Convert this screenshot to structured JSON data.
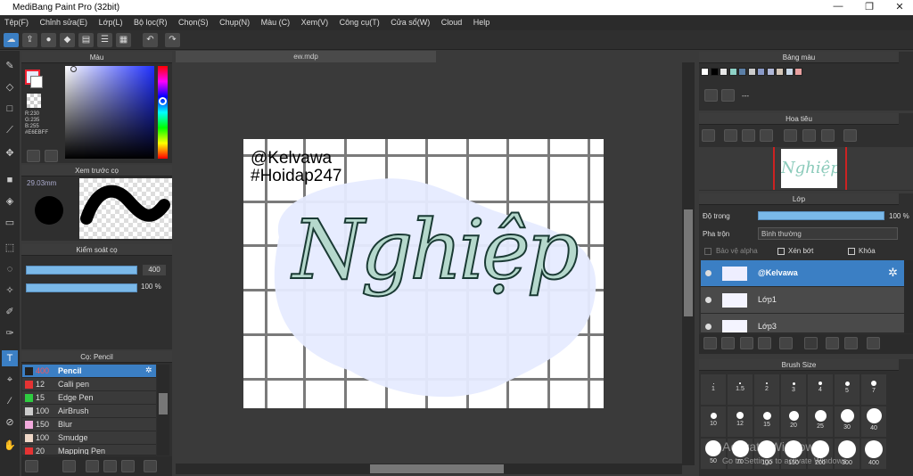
{
  "title": "MediBang Paint Pro (32bit)",
  "window_buttons": [
    "—",
    "❐",
    "✕"
  ],
  "menu": [
    "Tệp(F)",
    "Chỉnh sửa(E)",
    "Lớp(L)",
    "Bộ lọc(R)",
    "Chọn(S)",
    "Chụp(N)",
    "Màu (C)",
    "Xem(V)",
    "Công cụ(T)",
    "Cửa sổ(W)",
    "Cloud",
    "Help"
  ],
  "color_panel": {
    "title": "Màu",
    "r": "R:230",
    "g": "G:235",
    "b": "B:255",
    "hex": "#E6EBFF",
    "primary": "#e6ebff",
    "secondary": "#ffffff"
  },
  "preview_panel": {
    "title": "Xem trước cọ",
    "size": "29.03mm"
  },
  "control_panel": {
    "title": "Kiểm soát cọ",
    "size_value": "400",
    "opacity_value": "100 %"
  },
  "brush_panel": {
    "title": "Cọ: Pencil",
    "brushes": [
      {
        "size": "400",
        "name": "Pencil",
        "color": "#222222",
        "selected": true
      },
      {
        "size": "12",
        "name": "Calli pen",
        "color": "#e53333"
      },
      {
        "size": "15",
        "name": "Edge Pen",
        "color": "#2ecc40"
      },
      {
        "size": "100",
        "name": "AirBrush",
        "color": "#cccccc"
      },
      {
        "size": "150",
        "name": "Blur",
        "color": "#f2aadd"
      },
      {
        "size": "100",
        "name": "Smudge",
        "color": "#f0d8c8"
      },
      {
        "size": "20",
        "name": "Mapping Pen",
        "color": "#e53333"
      }
    ]
  },
  "document": {
    "tab": "ew.mdp",
    "watermark_line1": "@Kelvawa",
    "watermark_line2": "#Hoidap247",
    "lettering": "Nghiệp"
  },
  "palette_panel": {
    "title": "Bảng màu",
    "swatches": [
      "#ffffff",
      "#000000",
      "#e8e8e8",
      "#8ed1c6",
      "#5b7fa6",
      "#cccccc",
      "#8a9ac8",
      "#b0b8d8",
      "#d4c6b8",
      "#c8d8e8",
      "#e8a0a0"
    ],
    "ellipsis": "---"
  },
  "navigator_panel": {
    "title": "Hoa tiêu"
  },
  "layer_panel": {
    "title": "Lớp",
    "opacity_label": "Độ trong",
    "opacity_value": "100 %",
    "blend_label": "Pha trộn",
    "blend_value": "Bình thường",
    "protect_alpha": "Bảo vệ alpha",
    "clipping": "Xén bớt",
    "lock": "Khóa",
    "layers": [
      {
        "name": "@Kelvawa",
        "selected": true
      },
      {
        "name": "Lớp1"
      },
      {
        "name": "Lớp3"
      }
    ]
  },
  "brush_size_panel": {
    "title": "Brush Size",
    "rows": [
      [
        "1",
        "1.5",
        "2",
        "3",
        "4",
        "5",
        "7"
      ],
      [
        "10",
        "12",
        "15",
        "20",
        "25",
        "30",
        "40"
      ],
      [
        "50",
        "70",
        "100",
        "150",
        "200",
        "300",
        "400"
      ]
    ]
  },
  "activation": {
    "line1": "Activate Windows",
    "line2": "Go to Settings to activate Windows."
  }
}
